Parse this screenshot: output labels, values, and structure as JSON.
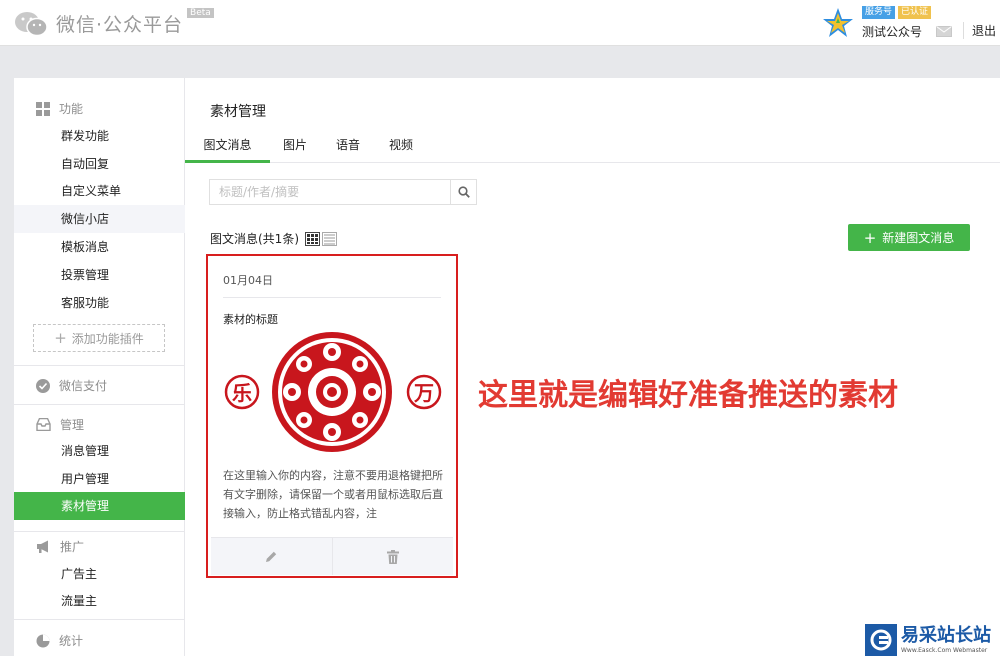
{
  "header": {
    "app_title": "微信·公众平台",
    "beta": "Beta",
    "account_type": "服务号",
    "verified": "已认证",
    "account_name": "测试公众号",
    "logout": "退出"
  },
  "sidebar": {
    "sections": [
      {
        "title": "功能",
        "icon": "grid-icon",
        "items": [
          "群发功能",
          "自动回复",
          "自定义菜单",
          "微信小店",
          "模板消息",
          "投票管理",
          "客服功能"
        ]
      },
      {
        "title": "微信支付",
        "icon": "check-circle-icon"
      },
      {
        "title": "管理",
        "icon": "inbox-icon",
        "items": [
          "消息管理",
          "用户管理",
          "素材管理"
        ]
      },
      {
        "title": "推广",
        "icon": "megaphone-icon",
        "items": [
          "广告主",
          "流量主"
        ]
      },
      {
        "title": "统计",
        "icon": "pie-chart-icon"
      }
    ],
    "add_plugin": "添加功能插件",
    "active_item": "素材管理",
    "highlighted_item": "微信小店"
  },
  "main": {
    "page_title": "素材管理",
    "tabs": [
      "图文消息",
      "图片",
      "语音",
      "视频"
    ],
    "active_tab": "图文消息",
    "search_placeholder": "标题/作者/摘要",
    "list_title": "图文消息(共1条)",
    "new_button": "新建图文消息",
    "card": {
      "date": "01月04日",
      "title": "素材的标题",
      "seal_left": "乐",
      "seal_right": "万",
      "description": "在这里输入你的内容，注意不要用退格键把所有文字删除，请保留一个或者用鼠标选取后直接输入，防止格式错乱内容，注"
    }
  },
  "annotation": "这里就是编辑好准备推送的素材",
  "watermark": {
    "main": "易采站长站",
    "sub": "Www.Easck.Com Webmaster"
  },
  "colors": {
    "accent_green": "#44b549",
    "highlight_red": "#d81e1e",
    "annotation_red": "#e23a32"
  }
}
